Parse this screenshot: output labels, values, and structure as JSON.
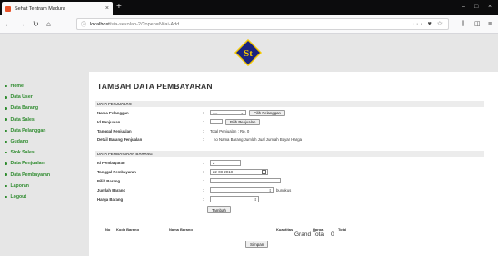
{
  "browser": {
    "tab_title": "Sehat Tentram Madura",
    "tab_close": "×",
    "new_tab": "+",
    "url_host": "localhost",
    "url_path": "/sia-sekolah-2/?open=Nilai-Add",
    "url_actions": "··· ♥ ☆",
    "win_min": "–",
    "win_max": "□",
    "win_close": "×"
  },
  "logo_text": "St",
  "colors": {
    "sidebar_link": "#2e8b2e",
    "header_bg": "#e6e6e6",
    "logo_fill": "#1a237e",
    "logo_text": "#f5c800"
  },
  "sidebar": {
    "items": [
      {
        "label": "Home"
      },
      {
        "label": "Data User"
      },
      {
        "label": "Data Barang"
      },
      {
        "label": "Data Sales"
      },
      {
        "label": "Data Pelanggan"
      },
      {
        "label": "Gudang"
      },
      {
        "label": "Stok Sales"
      },
      {
        "label": "Data Penjualan"
      },
      {
        "label": "Data Pembayaran"
      },
      {
        "label": "Laporan"
      },
      {
        "label": "Logout"
      }
    ]
  },
  "form": {
    "title": "TAMBAH DATA PEMBAYARAN",
    "section1": "DATA PENJUALAN",
    "section2": "DATA PEMBAYARAN BARANG",
    "colon": ":",
    "nama_pelanggan_label": "Nama Pelanggan",
    "nama_pelanggan_value": "----",
    "pilih_pelanggan_btn": "Pilih Pelanggan",
    "id_penjualan_label": "Id Penjualan",
    "id_penjualan_value": "----",
    "pilih_penjualan_btn": "Pilih Penjualan",
    "tanggal_penjualan_label": "Tanggal Penjualan",
    "tanggal_penjualan_value": "Total Penjualan : Rp. 0",
    "detail_label": "Detail Barang Penjualan",
    "detail_value": "no  Nama Barang  Jumlah Jual  Jumlah Bayar  Harga",
    "id_pembayaran_label": "Id Pembayaran",
    "id_pembayaran_value": "2",
    "tanggal_pembayaran_label": "Tanggal Pembayaran",
    "tanggal_pembayaran_value": "22-08-2018",
    "pilih_barang_label": "Pilih Barang",
    "pilih_barang_value": "----",
    "jumlah_barang_label": "Jumlah Barang",
    "jumlah_barang_unit": "bungkus",
    "harga_barang_label": "Harga Barang",
    "tambah_btn": "Tambah",
    "simpan_btn": "Simpan"
  },
  "table": {
    "columns": [
      "No",
      "Kode Barang",
      "Nama Barang",
      "Kuantitas",
      "Harga",
      "Total"
    ],
    "grand_total_label": "Grand Total",
    "grand_total_value": "0"
  }
}
